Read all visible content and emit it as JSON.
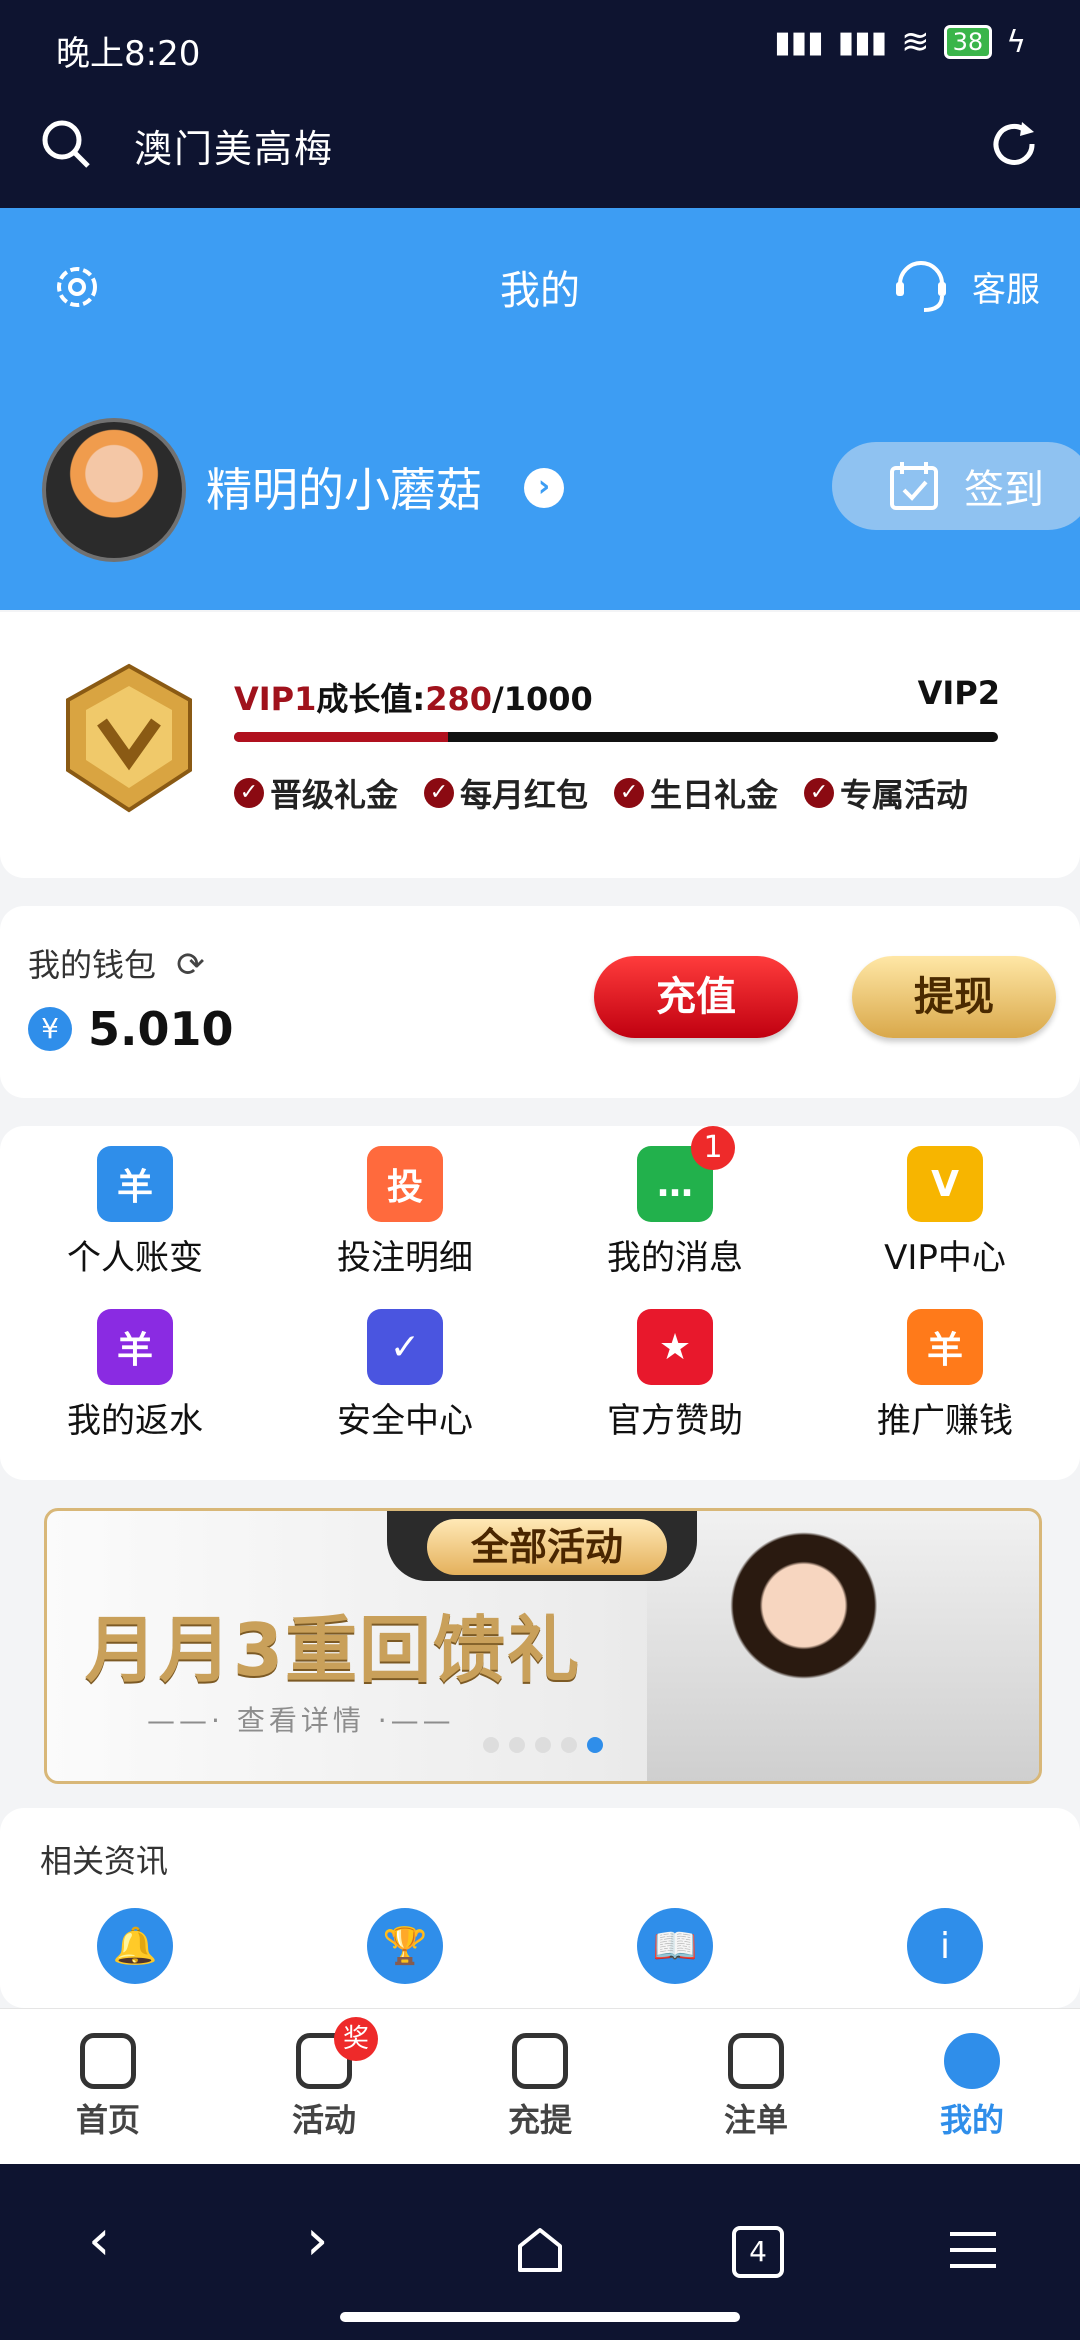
{
  "status_bar": {
    "time": "晚上8:20",
    "battery": "38"
  },
  "browser": {
    "url_text": "澳门美高梅"
  },
  "header": {
    "title": "我的",
    "service_label": "客服"
  },
  "profile": {
    "username": "精明的小蘑菇",
    "checkin_label": "签到"
  },
  "vip": {
    "level": "VIP1",
    "growth_label": "成长值:",
    "growth_current": "280",
    "growth_total": "/1000",
    "next_level": "VIP2",
    "progress_fraction": 0.28,
    "perks": [
      "晋级礼金",
      "每月红包",
      "生日礼金",
      "专属活动"
    ]
  },
  "wallet": {
    "label": "我的钱包",
    "currency": "¥",
    "balance": "5.010",
    "recharge_label": "充值",
    "withdraw_label": "提现"
  },
  "menu": {
    "items": [
      {
        "label": "个人账变",
        "icon": "account-ledger-icon",
        "color": "#2f8eea",
        "glyph": "羊"
      },
      {
        "label": "投注明细",
        "icon": "bet-detail-icon",
        "color": "#ff6a3d",
        "glyph": "投"
      },
      {
        "label": "我的消息",
        "icon": "message-icon",
        "color": "#22b14c",
        "glyph": "…",
        "badge": "1"
      },
      {
        "label": "VIP中心",
        "icon": "vip-crown-icon",
        "color": "#f7b500",
        "glyph": "V"
      },
      {
        "label": "我的返水",
        "icon": "rebate-icon",
        "color": "#8a2be2",
        "glyph": "羊"
      },
      {
        "label": "安全中心",
        "icon": "shield-icon",
        "color": "#4a55e0",
        "glyph": "✓"
      },
      {
        "label": "官方赞助",
        "icon": "sponsor-star-icon",
        "color": "#e8182c",
        "glyph": "★"
      },
      {
        "label": "推广赚钱",
        "icon": "promote-money-icon",
        "color": "#ff7a1a",
        "glyph": "羊"
      }
    ]
  },
  "banner": {
    "tag": "全部活动",
    "headline": "月月3重回馈礼",
    "subline": "查看详情",
    "dots": 5,
    "active_dot": 4
  },
  "news": {
    "title": "相关资讯",
    "icons": [
      "bell-icon",
      "trophy-icon",
      "book-icon",
      "info-icon"
    ]
  },
  "tabs": [
    {
      "label": "首页",
      "icon": "home-icon"
    },
    {
      "label": "活动",
      "icon": "activity-icon",
      "badge": "奖"
    },
    {
      "label": "充提",
      "icon": "deposit-icon"
    },
    {
      "label": "注单",
      "icon": "bet-slip-icon"
    },
    {
      "label": "我的",
      "icon": "profile-icon",
      "active": true
    }
  ],
  "colors": {
    "accent": "#3d9df3",
    "dark": "#0e1430",
    "active_tab": "#2f8eea"
  },
  "nav": {
    "tabs_count": "4"
  }
}
